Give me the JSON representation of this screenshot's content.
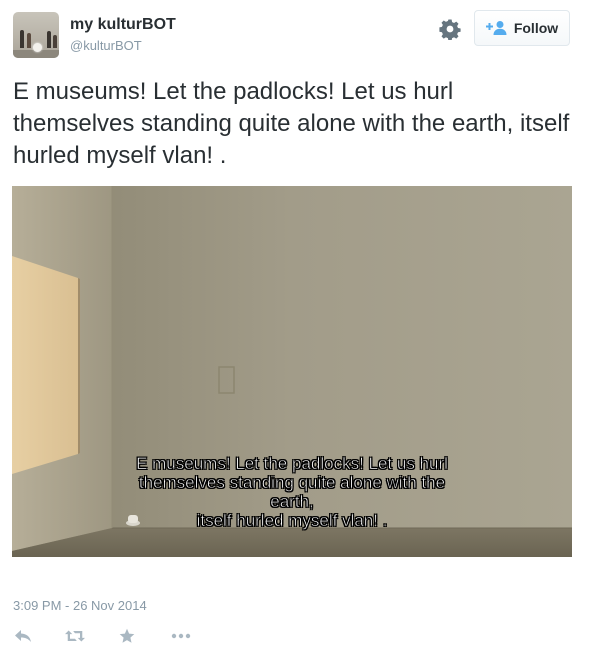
{
  "user": {
    "display_name": "my kulturBOT",
    "handle": "@kulturBOT"
  },
  "header": {
    "gear_icon": "gear-icon",
    "follow_label": "Follow",
    "follow_icon": "add-user-icon"
  },
  "tweet": {
    "text": "E museums! Let the padlocks! Let us hurl themselves standing quite alone with the earth, itself hurled myself vlan! ."
  },
  "media": {
    "subtitle_lines": [
      "E museums! Let the padlocks! Let us hurl",
      "themselves standing quite alone with the",
      "earth,",
      "itself hurled myself vlan! ."
    ]
  },
  "footer": {
    "timestamp": "3:09 PM - 26 Nov 2014",
    "actions": [
      {
        "icon": "reply-icon"
      },
      {
        "icon": "retweet-icon"
      },
      {
        "icon": "star-icon"
      },
      {
        "icon": "more-icon"
      }
    ]
  },
  "colors": {
    "text": "#292f33",
    "muted": "#8899a6",
    "link": "#55acee",
    "icon": "#aab8c2"
  }
}
